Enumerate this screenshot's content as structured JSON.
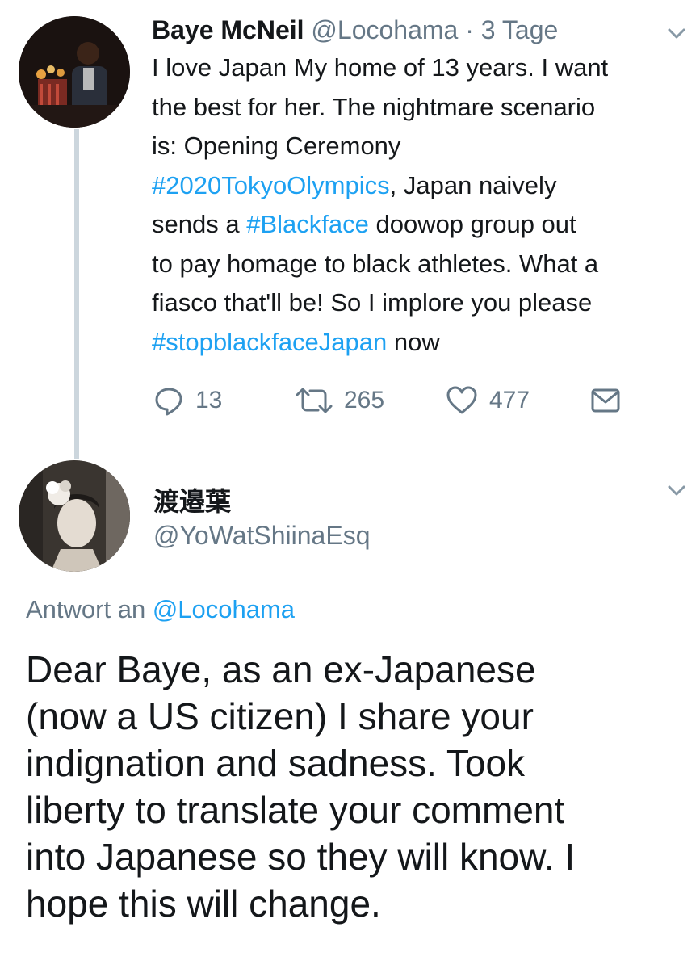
{
  "tweet1": {
    "display_name": "Baye McNeil",
    "handle": "@Locohama",
    "separator": "·",
    "time": "3 Tage",
    "lines": [
      [
        {
          "t": "I love Japan My home of 13 years. I want"
        }
      ],
      [
        {
          "t": "the best for her. The nightmare scenario"
        }
      ],
      [
        {
          "t": "is: Opening Ceremony"
        }
      ],
      [
        {
          "t": "#2020TokyoOlympics",
          "tag": true
        },
        {
          "t": ", Japan naively"
        }
      ],
      [
        {
          "t": "sends a "
        },
        {
          "t": "#Blackface",
          "tag": true
        },
        {
          "t": " doowop group out"
        }
      ],
      [
        {
          "t": "to pay homage to black athletes. What a"
        }
      ],
      [
        {
          "t": "fiasco that'll be! So I implore you please"
        }
      ],
      [
        {
          "t": "#stopblackfaceJapan",
          "tag": true
        },
        {
          "t": " now"
        }
      ]
    ],
    "actions": {
      "reply_count": "13",
      "retweet_count": "265",
      "like_count": "477"
    }
  },
  "tweet2": {
    "display_name": "渡邉葉",
    "handle": "@YoWatShiinaEsq",
    "reply_prefix": "Antwort an ",
    "reply_handle": "@Locohama",
    "lines": [
      "Dear Baye, as an ex-Japanese",
      "(now a US citizen) I share your",
      "indignation and sadness. Took",
      "liberty to translate your comment",
      "into Japanese so they will know. I",
      "hope this will change."
    ]
  },
  "icons": {
    "reply": "speech-bubble-icon",
    "retweet": "retweet-icon",
    "like": "heart-icon",
    "dm": "envelope-icon",
    "more": "chevron-down-icon"
  },
  "colors": {
    "link": "#1da1f2",
    "muted": "#657786",
    "text": "#14171a",
    "thread_line": "#ccd6dd"
  }
}
